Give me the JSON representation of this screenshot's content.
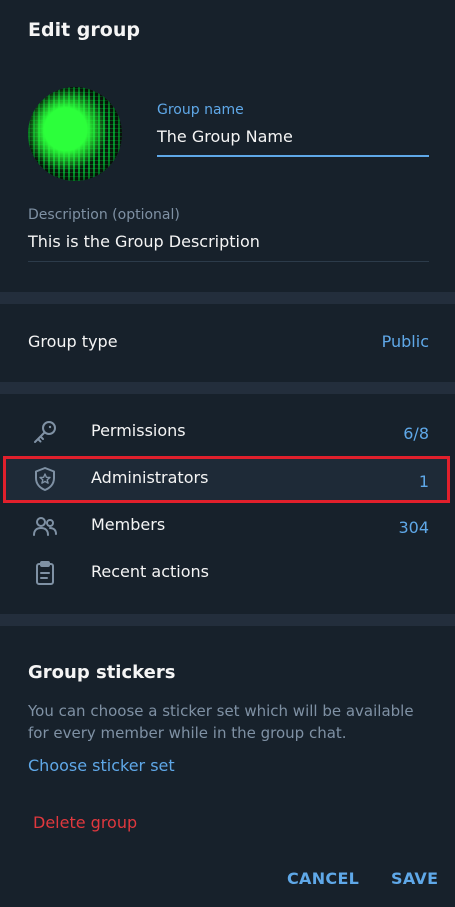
{
  "header": {
    "title": "Edit group"
  },
  "group": {
    "name_label": "Group name",
    "name_value": "The Group Name",
    "description_label": "Description (optional)",
    "description_value": "This is the Group Description"
  },
  "group_type": {
    "label": "Group type",
    "value": "Public"
  },
  "rows": [
    {
      "label": "Permissions",
      "value": "6/8",
      "icon": "key-icon"
    },
    {
      "label": "Administrators",
      "value": "1",
      "icon": "shield-star-icon"
    },
    {
      "label": "Members",
      "value": "304",
      "icon": "users-icon"
    },
    {
      "label": "Recent actions",
      "value": "",
      "icon": "clipboard-icon"
    }
  ],
  "stickers": {
    "title": "Group stickers",
    "description": "You can choose a sticker set which will be available for every member while in the group chat.",
    "choose_label": "Choose sticker set"
  },
  "delete_label": "Delete group",
  "buttons": {
    "cancel": "CANCEL",
    "save": "SAVE"
  },
  "colors": {
    "background": "#17212b",
    "accent": "#5fa8e8",
    "danger": "#e0383e",
    "highlight_border": "#e1202c"
  }
}
